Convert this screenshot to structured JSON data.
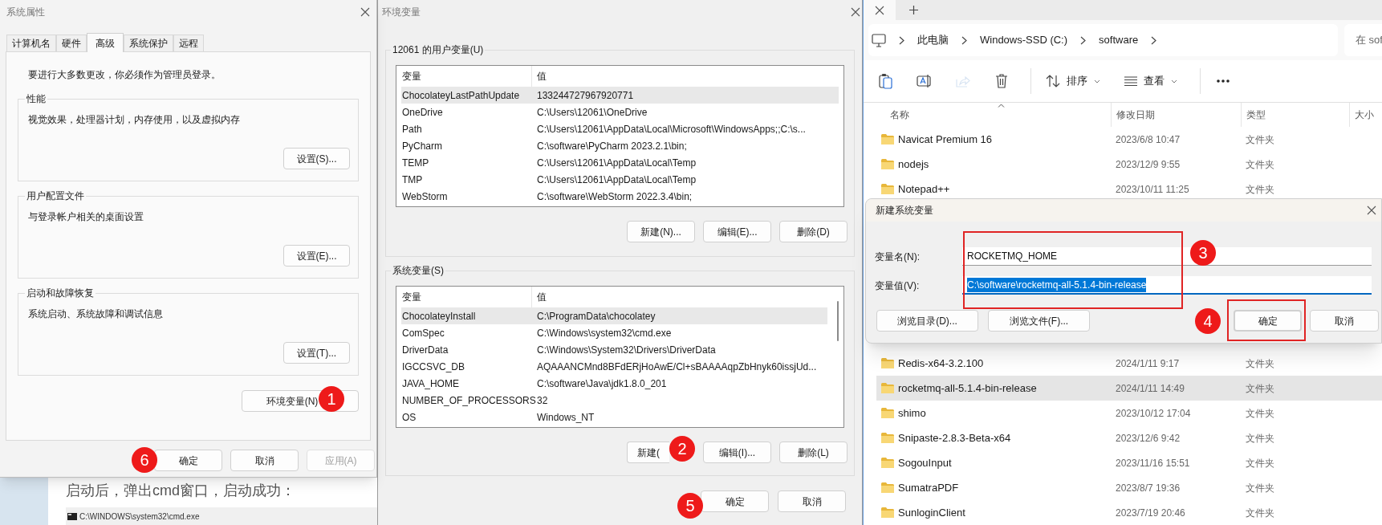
{
  "background": {
    "text": "启动后，弹出cmd窗口，启动成功：",
    "console_title": "C:\\WINDOWS\\system32\\cmd.exe"
  },
  "system_properties": {
    "title": "系统属性",
    "tabs": [
      {
        "label": "计算机名",
        "selected": false
      },
      {
        "label": "硬件",
        "selected": false
      },
      {
        "label": "高级",
        "selected": true
      },
      {
        "label": "系统保护",
        "selected": false
      },
      {
        "label": "远程",
        "selected": false
      }
    ],
    "notice": "要进行大多数更改，你必须作为管理员登录。",
    "groups": [
      {
        "title": "性能",
        "description": "视觉效果，处理器计划，内存使用，以及虚拟内存",
        "button": "设置(S)..."
      },
      {
        "title": "用户配置文件",
        "description": "与登录帐户相关的桌面设置",
        "button": "设置(E)..."
      },
      {
        "title": "启动和故障恢复",
        "description": "系统启动、系统故障和调试信息",
        "button": "设置(T)..."
      }
    ],
    "env_button": "环境变量(N)",
    "buttons": [
      {
        "label": "确定",
        "disabled": false
      },
      {
        "label": "取消",
        "disabled": false
      },
      {
        "label": "应用(A)",
        "disabled": true
      }
    ]
  },
  "environment_variables": {
    "title": "环境变量",
    "sections": [
      {
        "title": "12061 的用户变量(U)",
        "columns": [
          "变量",
          "值"
        ],
        "scrollbar": false,
        "rows": [
          {
            "name": "ChocolateyLastPathUpdate",
            "value": "133244727967920771",
            "selected": true
          },
          {
            "name": "OneDrive",
            "value": "C:\\Users\\12061\\OneDrive",
            "selected": false
          },
          {
            "name": "Path",
            "value": "C:\\Users\\12061\\AppData\\Local\\Microsoft\\WindowsApps;;C:\\s...",
            "selected": false
          },
          {
            "name": "PyCharm",
            "value": "C:\\software\\PyCharm 2023.2.1\\bin;",
            "selected": false
          },
          {
            "name": "TEMP",
            "value": "C:\\Users\\12061\\AppData\\Local\\Temp",
            "selected": false
          },
          {
            "name": "TMP",
            "value": "C:\\Users\\12061\\AppData\\Local\\Temp",
            "selected": false
          },
          {
            "name": "WebStorm",
            "value": "C:\\software\\WebStorm 2022.3.4\\bin;",
            "selected": false
          }
        ],
        "buttons": [
          "新建(N)...",
          "编辑(E)...",
          "删除(D)"
        ]
      },
      {
        "title": "系统变量(S)",
        "columns": [
          "变量",
          "值"
        ],
        "scrollbar": true,
        "rows": [
          {
            "name": "ChocolateyInstall",
            "value": "C:\\ProgramData\\chocolatey",
            "selected": true
          },
          {
            "name": "ComSpec",
            "value": "C:\\Windows\\system32\\cmd.exe",
            "selected": false
          },
          {
            "name": "DriverData",
            "value": "C:\\Windows\\System32\\Drivers\\DriverData",
            "selected": false
          },
          {
            "name": "IGCCSVC_DB",
            "value": "AQAAANCMnd8BFdERjHoAwE/Cl+sBAAAAqpZbHnyk60issjUd...",
            "selected": false
          },
          {
            "name": "JAVA_HOME",
            "value": "C:\\software\\Java\\jdk1.8.0_201",
            "selected": false
          },
          {
            "name": "NUMBER_OF_PROCESSORS",
            "value": "32",
            "selected": false
          },
          {
            "name": "OS",
            "value": "Windows_NT",
            "selected": false
          }
        ],
        "buttons": [
          "新建(",
          "编辑(I)...",
          "删除(L)"
        ]
      }
    ],
    "buttons": [
      "确定",
      "取消"
    ]
  },
  "explorer": {
    "breadcrumb": [
      "此电脑",
      "Windows-SSD (C:)",
      "software"
    ],
    "search_placeholder": "在 sof",
    "toolbar": [
      {
        "kind": "copy",
        "disabled": false
      },
      {
        "kind": "rename",
        "disabled": false
      },
      {
        "kind": "share",
        "disabled": true
      },
      {
        "kind": "delete",
        "disabled": false
      },
      {
        "kind": "sort",
        "label": "排序",
        "disabled": false
      },
      {
        "kind": "view",
        "label": "查看",
        "disabled": false
      },
      {
        "kind": "more",
        "disabled": false
      }
    ],
    "columns": [
      "名称",
      "修改日期",
      "类型",
      "大小"
    ],
    "rows": [
      {
        "name": "Navicat Premium 16",
        "date": "2023/6/8 10:47",
        "type": "文件夹",
        "selected": false
      },
      {
        "name": "nodejs",
        "date": "2023/12/9 9:55",
        "type": "文件夹",
        "selected": false
      },
      {
        "name": "Notepad++",
        "date": "2023/10/11 11:25",
        "type": "文件夹",
        "selected": false
      }
    ],
    "rows_below_dialog": [
      {
        "name": "Redis-x64-3.2.100",
        "date": "2024/1/11 9:17",
        "type": "文件夹",
        "selected": false
      },
      {
        "name": "rocketmq-all-5.1.4-bin-release",
        "date": "2024/1/11 14:49",
        "type": "文件夹",
        "selected": true
      },
      {
        "name": "shimo",
        "date": "2023/10/12 17:04",
        "type": "文件夹",
        "selected": false
      },
      {
        "name": "Snipaste-2.8.3-Beta-x64",
        "date": "2023/12/6 9:42",
        "type": "文件夹",
        "selected": false
      },
      {
        "name": "SogouInput",
        "date": "2023/11/16 15:51",
        "type": "文件夹",
        "selected": false
      },
      {
        "name": "SumatraPDF",
        "date": "2023/8/7 19:36",
        "type": "文件夹",
        "selected": false
      },
      {
        "name": "SunloginClient",
        "date": "2023/7/19 20:46",
        "type": "文件夹",
        "selected": false
      }
    ]
  },
  "new_variable_dialog": {
    "title": "新建系统变量",
    "fields": [
      {
        "label": "变量名(N):",
        "value": "ROCKETMQ_HOME",
        "selected": false
      },
      {
        "label": "变量值(V):",
        "value": "C:\\software\\rocketmq-all-5.1.4-bin-release",
        "selected": true
      }
    ],
    "buttons": [
      {
        "label": "浏览目录(D)...",
        "default": false
      },
      {
        "label": "浏览文件(F)...",
        "default": false
      },
      {
        "label": "确定",
        "default": true
      },
      {
        "label": "取消",
        "default": false
      }
    ]
  },
  "step_markers": [
    "1",
    "2",
    "3",
    "4",
    "5",
    "6"
  ]
}
